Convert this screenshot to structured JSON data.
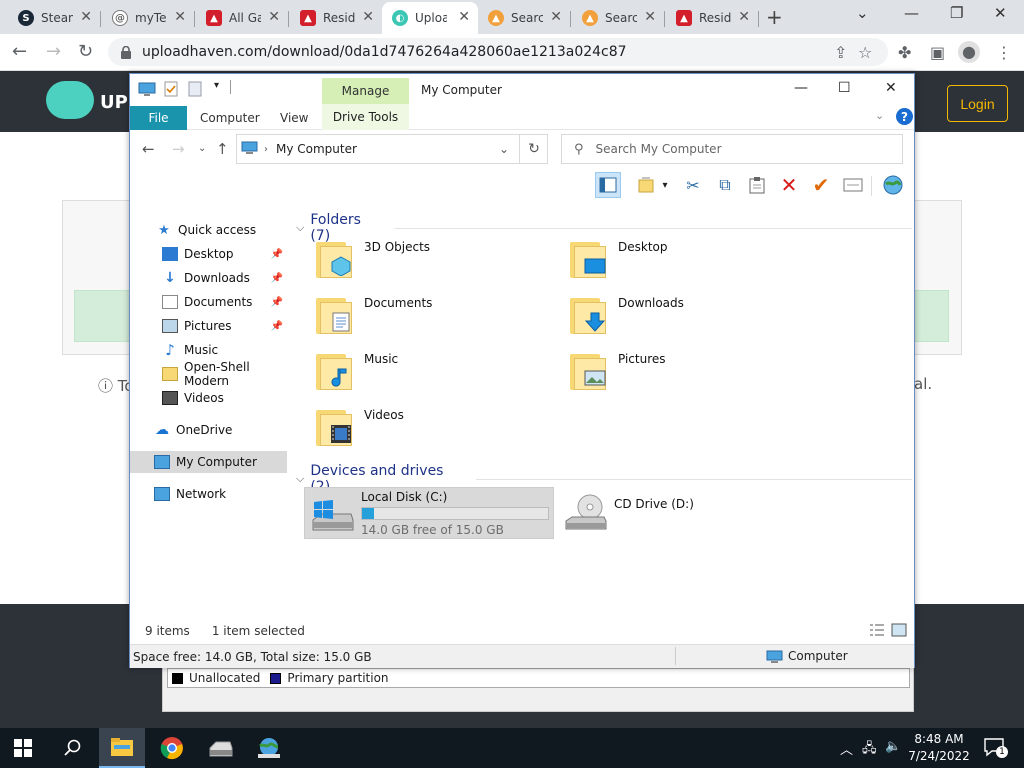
{
  "browser": {
    "tabs": [
      {
        "title": "Steam",
        "color": "#1b2838",
        "glyph": "S"
      },
      {
        "title": "myTeam",
        "color": "#888888",
        "glyph": "@"
      },
      {
        "title": "All Games",
        "color": "#d21f2b",
        "glyph": "▲"
      },
      {
        "title": "Resident",
        "color": "#d21f2b",
        "glyph": "▲"
      },
      {
        "title": "Upload",
        "color": "#3cc6b4",
        "glyph": "◐"
      },
      {
        "title": "Search",
        "color": "#f2a03c",
        "glyph": "▲"
      },
      {
        "title": "Search",
        "color": "#f2a03c",
        "glyph": "▲"
      },
      {
        "title": "Resident",
        "color": "#d21f2b",
        "glyph": "▲"
      }
    ],
    "url": "uploadhaven.com/download/0da1d7476264a428060ae1213a024c87"
  },
  "site": {
    "logo_text": "UP",
    "login_label": "Login",
    "info_prefix": "ⓘ To",
    "info_suffix": "al."
  },
  "disk_legend": {
    "unallocated": "Unallocated",
    "primary": "Primary partition"
  },
  "explorer": {
    "title": "My Computer",
    "manage_tab": "Manage",
    "ribbon_tabs": {
      "file": "File",
      "computer": "Computer",
      "view": "View",
      "drive_tools": "Drive Tools"
    },
    "address": "My Computer",
    "search_placeholder": "Search My Computer",
    "nav": {
      "quick_access": "Quick access",
      "desktop": "Desktop",
      "downloads": "Downloads",
      "documents": "Documents",
      "pictures": "Pictures",
      "music": "Music",
      "openshell": "Open-Shell Modern",
      "videos": "Videos",
      "onedrive": "OneDrive",
      "mycomputer": "My Computer",
      "network": "Network"
    },
    "folders_header": "Folders (7)",
    "folders": {
      "objects3d": "3D Objects",
      "desktop": "Desktop",
      "documents": "Documents",
      "downloads": "Downloads",
      "music": "Music",
      "pictures": "Pictures",
      "videos": "Videos"
    },
    "devices_header": "Devices and drives (2)",
    "drive_c": {
      "name": "Local Disk (C:)",
      "free": "14.0 GB free of 15.0 GB",
      "used_fraction": 0.067
    },
    "drive_d": {
      "name": "CD Drive (D:)"
    },
    "status": {
      "items": "9 items",
      "selected": "1 item selected"
    },
    "details": {
      "space": "Space free: 14.0 GB, Total size: 15.0 GB",
      "location": "Computer"
    }
  },
  "taskbar": {
    "time": "8:48 AM",
    "date": "7/24/2022",
    "notifications": "1"
  }
}
